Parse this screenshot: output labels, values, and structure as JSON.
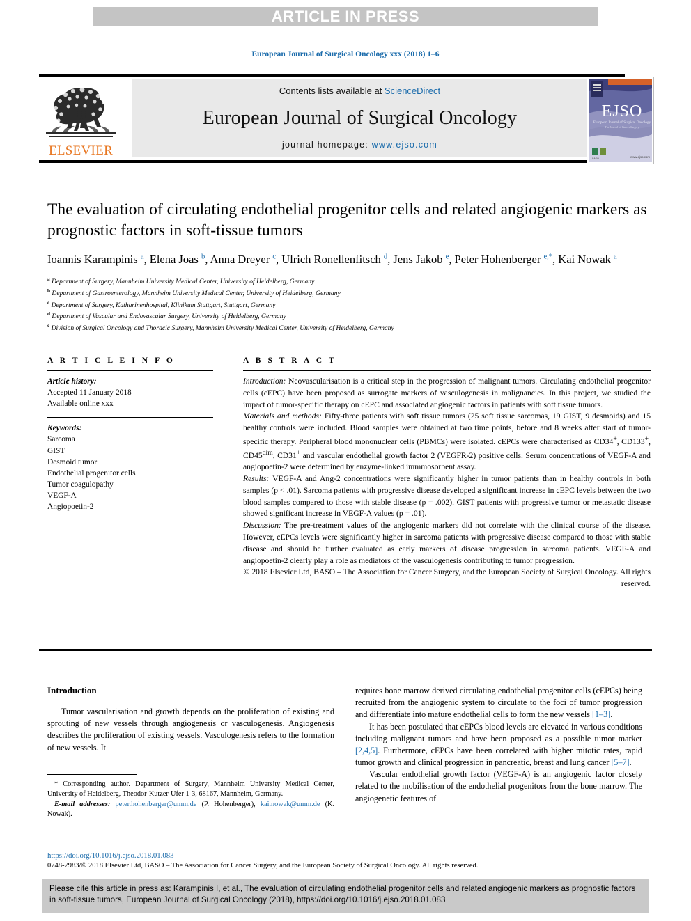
{
  "banner": {
    "label": "ARTICLE IN PRESS"
  },
  "running_head": "European Journal of Surgical Oncology xxx (2018) 1–6",
  "masthead": {
    "publisher_name": "ELSEVIER",
    "contents_prefix": "Contents lists available at ",
    "contents_link": "ScienceDirect",
    "journal_title": "European Journal of Surgical Oncology",
    "homepage_prefix": "journal homepage: ",
    "homepage_url": "www.ejso.com",
    "cover_acronym": "EJSO",
    "cover_subtitle": "European Journal of Surgical Oncology",
    "cover_tagline": "The Journal of Cancer Surgery",
    "cover_url": "www.ejso.com"
  },
  "article": {
    "title": "The evaluation of circulating endothelial progenitor cells and related angiogenic markers as prognostic factors in soft-tissue tumors",
    "authors_html": "Ioannis Karampinis <sup>a</sup>, Elena Joas <sup>b</sup>, Anna Dreyer <sup>c</sup>, Ulrich Ronellenfitsch <sup>d</sup>, Jens Jakob <sup>e</sup>, Peter Hohenberger <sup>e,&#42;</sup>, Kai Nowak <sup>a</sup>",
    "affiliations": [
      {
        "mark": "a",
        "text": "Department of Surgery, Mannheim University Medical Center, University of Heidelberg, Germany"
      },
      {
        "mark": "b",
        "text": "Department of Gastroenterology, Mannheim University Medical Center, University of Heidelberg, Germany"
      },
      {
        "mark": "c",
        "text": "Department of Surgery, Katharinenhospital, Klinikum Stuttgart, Stuttgart, Germany"
      },
      {
        "mark": "d",
        "text": "Department of Vascular and Endovascular Surgery, University of Heidelberg, Germany"
      },
      {
        "mark": "e",
        "text": "Division of Surgical Oncology and Thoracic Surgery, Mannheim University Medical Center, University of Heidelberg, Germany"
      }
    ]
  },
  "article_info": {
    "heading": "A R T I C L E   I N F O",
    "history_label": "Article history:",
    "history_lines": [
      "Accepted 11 January 2018",
      "Available online xxx"
    ],
    "keywords_label": "Keywords:",
    "keywords": [
      "Sarcoma",
      "GIST",
      "Desmoid tumor",
      "Endothelial progenitor cells",
      "Tumor coagulopathy",
      "VEGF-A",
      "Angiopoetin-2"
    ]
  },
  "abstract": {
    "heading": "A B S T R A C T",
    "sections": [
      {
        "label": "Introduction:",
        "text": " Neovascularisation is a critical step in the progression of malignant tumors. Circulating endothelial progenitor cells (cEPC) have been proposed as surrogate markers of vasculogenesis in malignancies. In this project, we studied the impact of tumor-specific therapy on cEPC and associated angiogenic factors in patients with soft tissue tumors."
      },
      {
        "label": "Materials and methods:",
        "text": " Fifty-three patients with soft tissue tumors (25 soft tissue sarcomas, 19 GIST, 9 desmoids) and 15 healthy controls were included. Blood samples were obtained at two time points, before and 8 weeks after start of tumor-specific therapy. Peripheral blood mononuclear cells (PBMCs) were isolated. cEPCs were characterised as CD34+, CD133+, CD45dim, CD31+ and vascular endothelial growth factor 2 (VEGFR-2) positive cells. Serum concentrations of VEGF-A and angiopoetin-2 were determined by enzyme-linked immmosorbent assay."
      },
      {
        "label": "Results:",
        "text": " VEGF-A and Ang-2 concentrations were significantly higher in tumor patients than in healthy controls in both samples (p < .01). Sarcoma patients with progressive disease developed a significant increase in cEPC levels between the two blood samples compared to those with stable disease (p = .002). GIST patients with progressive tumor or metastatic disease showed significant increase in VEGF-A values (p = .01)."
      },
      {
        "label": "Discussion:",
        "text": " The pre-treatment values of the angiogenic markers did not correlate with the clinical course of the disease. However, cEPCs levels were significantly higher in sarcoma patients with progressive disease compared to those with stable disease and should be further evaluated as early markers of disease progression in sarcoma patients. VEGF-A and angiopoetin-2 clearly play a role as mediators of the vasculogenesis contributing to tumor progression."
      }
    ],
    "copyright": "© 2018 Elsevier Ltd, BASO – The Association for Cancer Surgery, and the European Society of Surgical Oncology. All rights reserved."
  },
  "body": {
    "intro_heading": "Introduction",
    "left_paragraphs": [
      "Tumor vascularisation and growth depends on the proliferation of existing and sprouting of new vessels through angiogenesis or vasculogenesis. Angiogenesis describes the proliferation of existing vessels. Vasculogenesis refers to the formation of new vessels. It"
    ],
    "right_paragraphs": [
      "requires bone marrow derived circulating endothelial progenitor cells (cEPCs) being recruited from the angiogenic system to circulate to the foci of tumor progression and differentiate into mature endothelial cells to form the new vessels [1–3].",
      "It has been postulated that cEPCs blood levels are elevated in various conditions including malignant tumors and have been proposed as a possible tumor marker [2,4,5]. Furthermore, cEPCs have been correlated with higher mitotic rates, rapid tumor growth and clinical progression in pancreatic, breast and lung cancer [5–7].",
      "Vascular endothelial growth factor (VEGF-A) is an angiogenic factor closely related to the mobilisation of the endothelial progenitors from the bone marrow. The angiogenetic features of"
    ]
  },
  "footnotes": {
    "corresponding": "* Corresponding author. Department of Surgery, Mannheim University Medical Center, University of Heidelberg, Theodor-Kutzer-Ufer 1-3, 68167, Mannheim, Germany.",
    "email_label": "E-mail addresses:",
    "email_1": "peter.hohenberger@umm.de",
    "email_1_owner": "(P. Hohenberger)",
    "email_2": "kai.nowak@umm.de",
    "email_2_owner": "(K. Nowak).",
    "doi": "https://doi.org/10.1016/j.ejso.2018.01.083",
    "issn_line": "0748-7983/© 2018 Elsevier Ltd, BASO – The Association for Cancer Surgery, and the European Society of Surgical Oncology. All rights reserved."
  },
  "cite_box": {
    "text": "Please cite this article in press as: Karampinis I, et al., The evaluation of circulating endothelial progenitor cells and related angiogenic markers as prognostic factors in soft-tissue tumors, European Journal of Surgical Oncology (2018), https://doi.org/10.1016/j.ejso.2018.01.083"
  },
  "colors": {
    "link": "#1a6bab",
    "banner_bg": "#c4c4c4",
    "masthead_band": "#e9e9e9",
    "elsevier_orange": "#e87722",
    "cite_bg": "#c9c9c9"
  }
}
